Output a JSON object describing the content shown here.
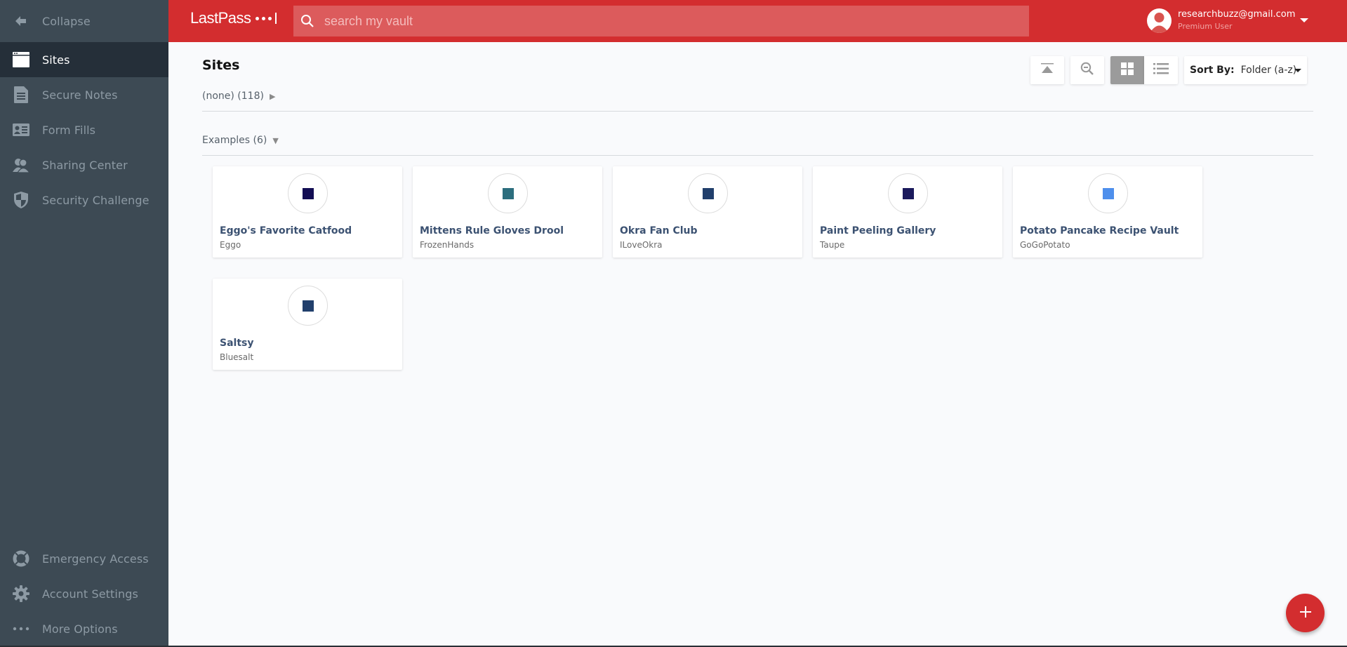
{
  "sidebar": {
    "collapse_label": "Collapse",
    "items": [
      {
        "label": "Sites",
        "icon": "browser-window-icon",
        "active": true
      },
      {
        "label": "Secure Notes",
        "icon": "document-icon"
      },
      {
        "label": "Form Fills",
        "icon": "id-card-icon"
      },
      {
        "label": "Sharing Center",
        "icon": "users-icon"
      },
      {
        "label": "Security Challenge",
        "icon": "shield-icon"
      }
    ],
    "bottom_items": [
      {
        "label": "Emergency Access",
        "icon": "lifebuoy-icon"
      },
      {
        "label": "Account Settings",
        "icon": "gear-icon"
      },
      {
        "label": "More Options",
        "icon": "more-dots-icon"
      }
    ]
  },
  "header": {
    "logo": "LastPass",
    "search_placeholder": "search my vault",
    "search_value": "",
    "user_email": "researchbuzz@gmail.com",
    "user_role": "Premium User"
  },
  "main": {
    "title": "Sites",
    "toolbar": {
      "collapse_all_icon": "collapse-all-icon",
      "zoom_out_icon": "zoom-out-icon",
      "grid_view_icon": "grid-view-icon",
      "list_view_icon": "list-view-icon",
      "active_view": "grid",
      "sort_label": "Sort By:",
      "sort_value": "Folder (a-z)"
    },
    "folders": [
      {
        "label": "(none) (118)",
        "expanded": false
      },
      {
        "label": "Examples (6)",
        "expanded": true
      }
    ],
    "arrows": {
      "collapsed": "▶",
      "expanded": "▼"
    },
    "sites": [
      {
        "name": "Eggo's Favorite Catfood",
        "username": "Eggo",
        "color": "#130e54"
      },
      {
        "name": "Mittens Rule Gloves Drool",
        "username": "FrozenHands",
        "color": "#2c6e7e"
      },
      {
        "name": "Okra Fan Club",
        "username": "ILoveOkra",
        "color": "#213f6c"
      },
      {
        "name": "Paint Peeling Gallery",
        "username": "Taupe",
        "color": "#1b1a5c"
      },
      {
        "name": "Potato Pancake Recipe Vault",
        "username": "GoGoPotato",
        "color": "#4e8fec"
      },
      {
        "name": "Saltsy",
        "username": "Bluesalt",
        "color": "#213f6c"
      }
    ]
  },
  "fab": {
    "label": "+",
    "icon": "add-icon"
  },
  "colors": {
    "brand": "#d32d2f",
    "sidebar": "#3d4a54",
    "sidebar_active": "#252f39"
  }
}
